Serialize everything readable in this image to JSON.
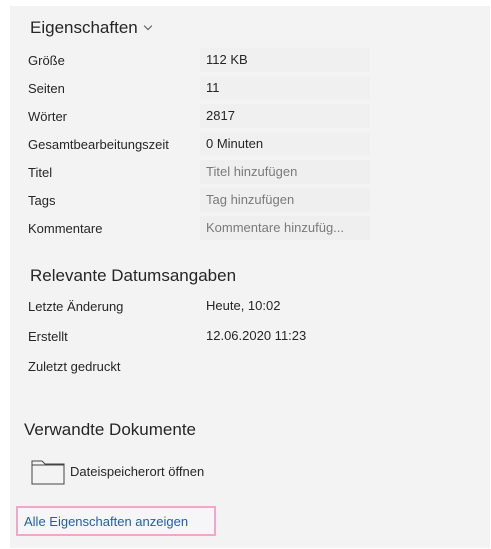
{
  "properties": {
    "title": "Eigenschaften",
    "rows": [
      {
        "label": "Größe",
        "value": "112 KB"
      },
      {
        "label": "Seiten",
        "value": "11"
      },
      {
        "label": "Wörter",
        "value": "2817"
      },
      {
        "label": "Gesamtbearbeitungszeit",
        "value": "0 Minuten"
      },
      {
        "label": "Titel",
        "placeholder": "Titel hinzufügen"
      },
      {
        "label": "Tags",
        "placeholder": "Tag hinzufügen"
      },
      {
        "label": "Kommentare",
        "placeholder": "Kommentare hinzufüg..."
      }
    ]
  },
  "dates": {
    "title": "Relevante Datumsangaben",
    "rows": [
      {
        "label": "Letzte Änderung",
        "value": "Heute, 10:02"
      },
      {
        "label": "Erstellt",
        "value": "12.06.2020 11:23"
      },
      {
        "label": "Zuletzt gedruckt",
        "value": ""
      }
    ]
  },
  "related": {
    "title": "Verwandte Dokumente",
    "open_location_label": "Dateispeicherort öffnen",
    "folder_icon": "folder-icon"
  },
  "show_all_label": "Alle Eigenschaften anzeigen",
  "colors": {
    "link": "#1f5faa",
    "highlight_border": "#f2a7c8",
    "panel_bg": "#f3f3f3"
  }
}
